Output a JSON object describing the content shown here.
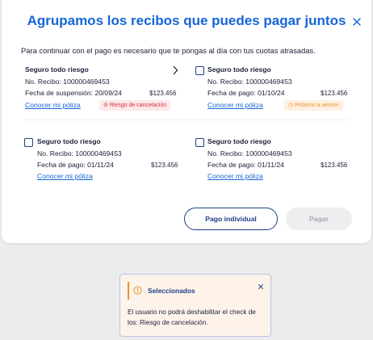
{
  "modal": {
    "title": "Agrupamos los recibos que puedes pagar juntos",
    "subtitle": "Para continuar con el pago es necesario que te pongas al día con tus cuotas atrasadas."
  },
  "cards": [
    {
      "title": "Seguro todo riesgo",
      "receipt": "No. Recibo: 100000469453",
      "date": "Fecha de suspensión: 20/09/24",
      "amount": "$123.456",
      "link": "Conocer mi póliza",
      "badge": "Riesgo de cancelación",
      "badge_type": "danger",
      "control": "chevron-right-icon"
    },
    {
      "title": "Seguro todo riesgo",
      "receipt": "No. Recibo: 100000469453",
      "date": "Fecha de pago: 01/10/24",
      "amount": "$123.456",
      "link": "Conocer mi póliza",
      "badge": "Próximo a vencer",
      "badge_type": "warn",
      "control": "checkbox",
      "checked": false
    },
    {
      "title": "Seguro todo riesgo",
      "receipt": "No. Recibo: 100000469453",
      "date": "Fecha de pago: 01/11/24",
      "amount": "$123.456",
      "link": "Conocer mi póliza",
      "control": "checkbox",
      "checked": false
    },
    {
      "title": "Seguro todo riesgo",
      "receipt": "No. Recibo: 100000469453",
      "date": "Fecha de pago: 01/11/24",
      "amount": "$123.456",
      "link": "Conocer mi póliza",
      "control": "checkbox",
      "checked": false
    }
  ],
  "actions": {
    "individual_label": "Pago individual",
    "pay_label": "Pagar"
  },
  "toast": {
    "title": "Seleccionados",
    "message": "El usuario no podrá deshabilitar el check de los: Riesgo de cancelación."
  },
  "colors": {
    "primary": "#1565d8",
    "navy": "#1d3f86",
    "danger": "#d6303f",
    "warning": "#e99432",
    "background": "#ececec"
  }
}
